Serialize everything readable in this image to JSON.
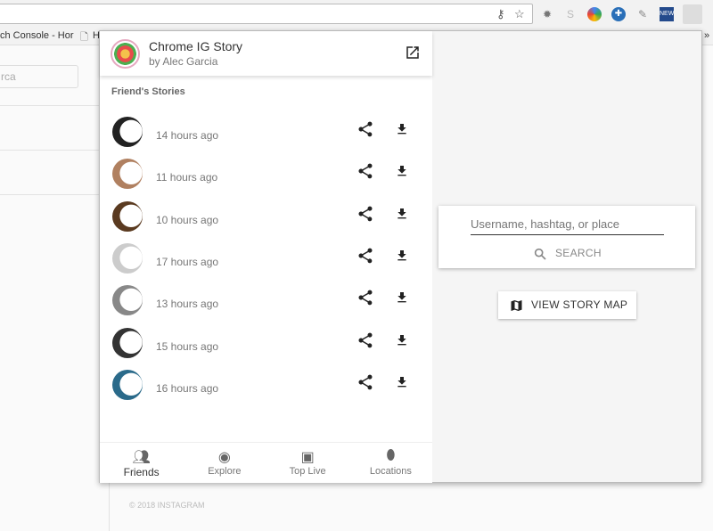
{
  "browser": {
    "bookmark_1": "ch Console - Hor",
    "bookmark_2": "H",
    "overflow": "»",
    "extensions": [
      "key-icon",
      "star-icon",
      "bug-icon",
      "skype-icon",
      "chrome-icon",
      "extension-icon",
      "pen-icon",
      "news-icon",
      "ig-story-icon"
    ]
  },
  "background_page": {
    "search_placeholder": "rca",
    "footer": "© 2018 INSTAGRAM"
  },
  "popup": {
    "title": "Chrome IG Story",
    "subtitle": "by Alec Garcia",
    "section_title": "Friend's Stories",
    "stories": [
      {
        "time": "14 hours ago"
      },
      {
        "time": "11 hours ago"
      },
      {
        "time": "10 hours ago"
      },
      {
        "time": "17 hours ago"
      },
      {
        "time": "13 hours ago"
      },
      {
        "time": "15 hours ago"
      },
      {
        "time": "16 hours ago"
      }
    ],
    "nav": [
      {
        "label": "Friends",
        "icon": "people-icon",
        "active": true
      },
      {
        "label": "Explore",
        "icon": "compass-icon"
      },
      {
        "label": "Top Live",
        "icon": "tv-icon"
      },
      {
        "label": "Locations",
        "icon": "location-pin-icon"
      }
    ],
    "search": {
      "placeholder": "Username, hashtag, or place",
      "button": "SEARCH"
    },
    "map_button": "VIEW STORY MAP"
  }
}
